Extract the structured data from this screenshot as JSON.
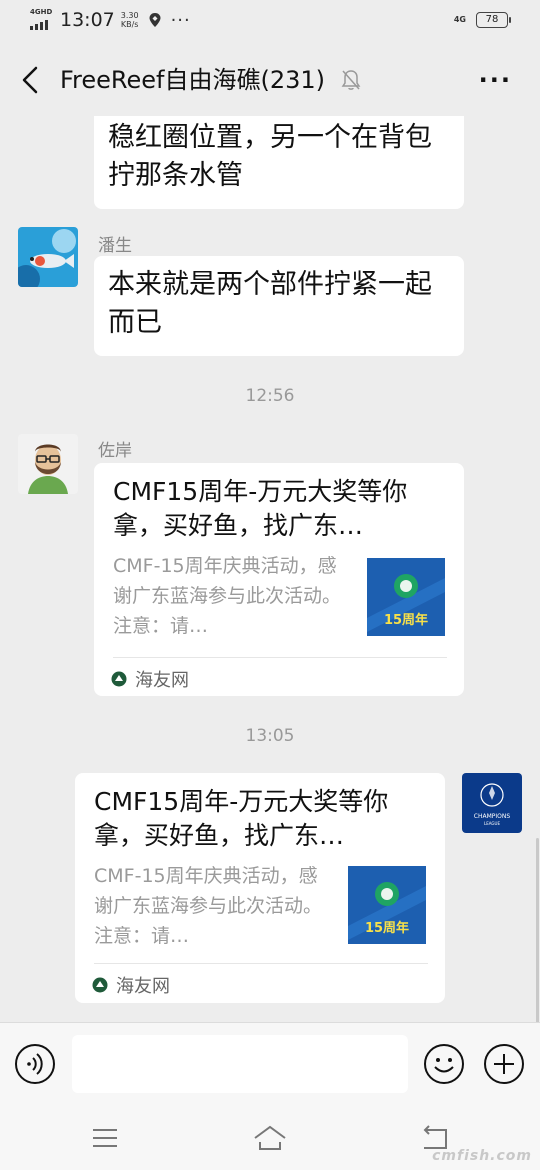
{
  "status_bar": {
    "network_left": "4GHD",
    "time": "13:07",
    "speed_value": "3.30",
    "speed_unit": "KB/s",
    "more": "···",
    "network_right": "4G",
    "battery": "78"
  },
  "header": {
    "title": "FreeReef自由海礁(231)",
    "more": "···"
  },
  "messages": [
    {
      "text": "稳红圈位置，另一个在背包拧那条水管"
    },
    {
      "sender": "潘生",
      "text": "本来就是两个部件拧紧一起而已"
    },
    {
      "timestamp": "12:56"
    },
    {
      "sender": "佐岸",
      "card": {
        "title": "CMF15周年-万元大奖等你拿，买好鱼，找广东…",
        "desc": "CMF-15周年庆典活动，感谢广东蓝海参与此次活动。注意：请…",
        "thumb_label": "15周年",
        "source": "海友网"
      }
    },
    {
      "timestamp": "13:05"
    },
    {
      "card": {
        "title": "CMF15周年-万元大奖等你拿，买好鱼，找广东…",
        "desc": "CMF-15周年庆典活动，感谢广东蓝海参与此次活动。注意：请…",
        "thumb_label": "15周年",
        "source": "海友网"
      },
      "avatar_text": [
        "CHAMPIONS",
        "LEAGUE"
      ]
    }
  ],
  "input": {
    "placeholder": ""
  },
  "watermark": "cmfish.com",
  "colors": {
    "background": "#ededed",
    "bubble": "#ffffff",
    "accent_green": "#1fa463",
    "thumb_blue": "#1d5fb0"
  }
}
